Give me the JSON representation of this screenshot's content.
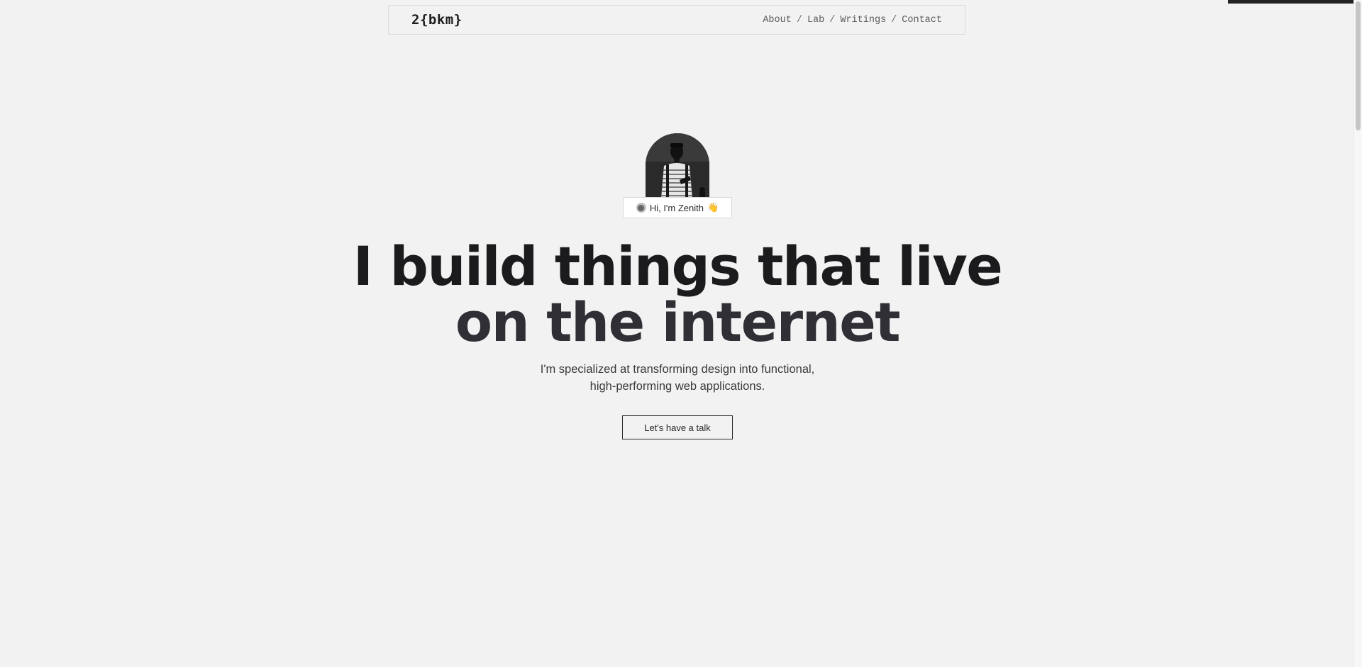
{
  "header": {
    "logo": "2{bkm}",
    "nav": [
      {
        "label": "About"
      },
      {
        "label": "Lab"
      },
      {
        "label": "Writings"
      },
      {
        "label": "Contact"
      }
    ],
    "separator": "/"
  },
  "hero": {
    "greeting": "Hi, I'm Zenith",
    "greeting_emoji": "👋",
    "headline_line1": "I build things that live",
    "headline_line2": "on the internet",
    "subtitle_line1": "I'm specialized at transforming design into functional,",
    "subtitle_line2": "high-performing web applications.",
    "cta_label": "Let's have a talk"
  },
  "colors": {
    "background": "#f2f2f2",
    "text": "#1f1f1f",
    "headline": "#2f2f35"
  }
}
